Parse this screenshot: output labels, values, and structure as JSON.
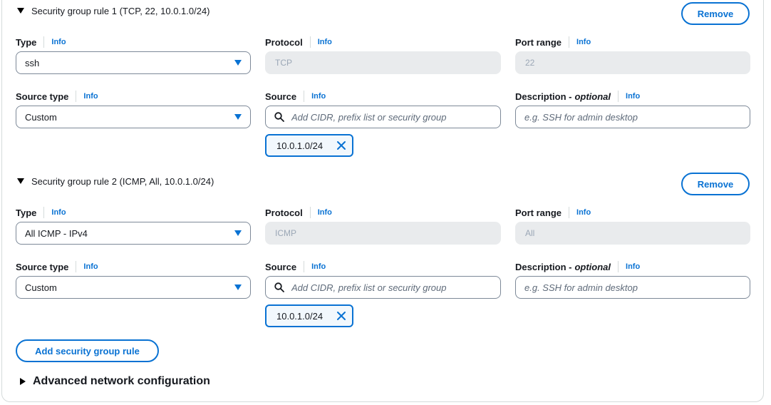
{
  "rules": [
    {
      "header": "Security group rule 1 (TCP, 22, 10.0.1.0/24)",
      "remove_label": "Remove",
      "type_label": "Type",
      "type_value": "ssh",
      "protocol_label": "Protocol",
      "protocol_value": "TCP",
      "port_label": "Port range",
      "port_value": "22",
      "source_type_label": "Source type",
      "source_type_value": "Custom",
      "source_label": "Source",
      "source_placeholder": "Add CIDR, prefix list or security group",
      "desc_label": "Description - ",
      "desc_optional": "optional",
      "desc_placeholder": "e.g. SSH for admin desktop",
      "token": "10.0.1.0/24"
    },
    {
      "header": "Security group rule 2 (ICMP, All, 10.0.1.0/24)",
      "remove_label": "Remove",
      "type_label": "Type",
      "type_value": "All ICMP - IPv4",
      "protocol_label": "Protocol",
      "protocol_value": "ICMP",
      "port_label": "Port range",
      "port_value": "All",
      "source_type_label": "Source type",
      "source_type_value": "Custom",
      "source_label": "Source",
      "source_placeholder": "Add CIDR, prefix list or security group",
      "desc_label": "Description - ",
      "desc_optional": "optional",
      "desc_placeholder": "e.g. SSH for admin desktop",
      "token": "10.0.1.0/24"
    }
  ],
  "info_label": "Info",
  "add_rule_label": "Add security group rule",
  "advanced_label": "Advanced network configuration",
  "colors": {
    "accent": "#0972d3",
    "disabled_bg": "#e9ebed",
    "border": "#7d8998"
  },
  "icons": {
    "expand": "caret-down-icon",
    "collapsed": "caret-right-icon",
    "dropdown": "triangle-down-icon",
    "search": "search-icon",
    "dismiss": "close-icon"
  }
}
